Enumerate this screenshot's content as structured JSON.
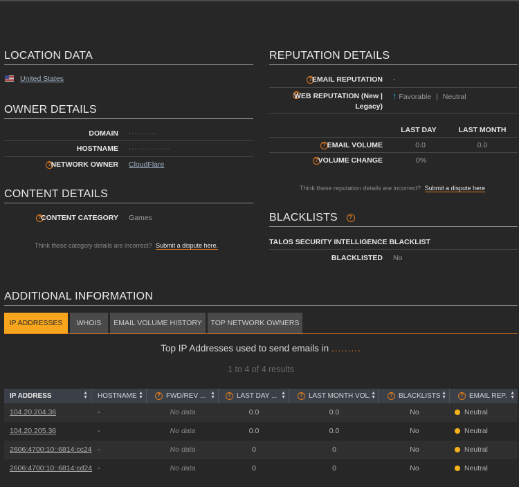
{
  "location": {
    "title": "LOCATION DATA",
    "country": "United States"
  },
  "owner": {
    "title": "OWNER DETAILS",
    "domain_label": "DOMAIN",
    "domain_value": "..........",
    "hostname_label": "HOSTNAME",
    "hostname_value": "...............",
    "network_owner_label": "NETWORK OWNER",
    "network_owner_value": "CloudFlare"
  },
  "content": {
    "title": "CONTENT DETAILS",
    "category_label": "CONTENT CATEGORY",
    "category_value": "Games",
    "dispute_text": "Think these category details are incorrect?",
    "dispute_link": "Submit a dispute here."
  },
  "reputation": {
    "title": "REPUTATION DETAILS",
    "email_rep_label": "EMAIL REPUTATION",
    "email_rep_value": "-",
    "web_rep_label_1": "WEB REPUTATION (New |",
    "web_rep_label_2": "Legacy)",
    "web_rep_value": "Favorable",
    "web_rep_sep": "|",
    "web_rep_legacy": "Neutral",
    "col_last_day": "LAST DAY",
    "col_last_month": "LAST MONTH",
    "email_volume_label": "EMAIL VOLUME",
    "email_volume_day": "0.0",
    "email_volume_month": "0.0",
    "volume_change_label": "VOLUME CHANGE",
    "volume_change_value": "0%",
    "dispute_text": "Think these reputation details are incorrect?",
    "dispute_link": "Submit a dispute here"
  },
  "blacklists": {
    "title": "BLACKLISTS",
    "subheader": "TALOS SECURITY INTELLIGENCE BLACKLIST",
    "blacklisted_label": "BLACKLISTED",
    "blacklisted_value": "No"
  },
  "additional": {
    "title": "ADDITIONAL INFORMATION",
    "tabs": [
      "IP ADDRESSES",
      "WHOIS",
      "EMAIL VOLUME HISTORY",
      "TOP NETWORK OWNERS"
    ],
    "heading": "Top IP Addresses used to send emails in",
    "heading_domain": ".........",
    "results": "1 to 4 of 4 results",
    "columns": [
      "IP ADDRESS",
      "HOSTNAME",
      "FWD/REV ...",
      "LAST DAY ...",
      "LAST MONTH VOL.",
      "BLACKLISTS",
      "EMAIL REP."
    ],
    "rows": [
      {
        "ip": "104.20.204.36",
        "hostname": "-",
        "fwd": "No data",
        "day": "0.0",
        "month": "0.0",
        "bl": "No",
        "rep": "Neutral"
      },
      {
        "ip": "104.20.205.36",
        "hostname": "-",
        "fwd": "No data",
        "day": "0.0",
        "month": "0.0",
        "bl": "No",
        "rep": "Neutral"
      },
      {
        "ip": "2606:4700:10::6814:cc24",
        "hostname": "-",
        "fwd": "No data",
        "day": "0",
        "month": "0",
        "bl": "No",
        "rep": "Neutral"
      },
      {
        "ip": "2606:4700:10::6814:cd24",
        "hostname": "-",
        "fwd": "No data",
        "day": "0",
        "month": "0",
        "bl": "No",
        "rep": "Neutral"
      }
    ]
  },
  "colors": {
    "accent": "#f7a51c",
    "help_icon": "#e07b1f",
    "favorable_arrow": "#2aa8e6",
    "background": "#272727"
  }
}
